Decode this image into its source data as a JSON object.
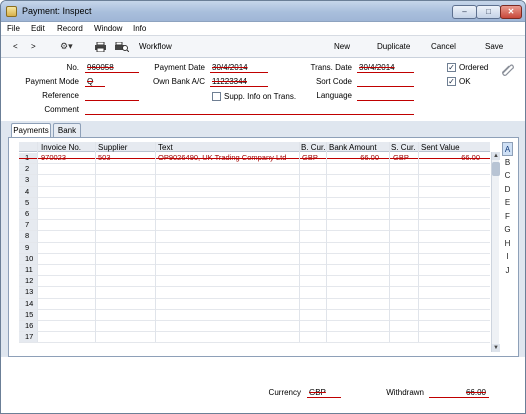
{
  "window": {
    "title": "Payment: Inspect",
    "min": "–",
    "max": "□",
    "close": "✕"
  },
  "menu": [
    "File",
    "Edit",
    "Record",
    "Window",
    "Info"
  ],
  "toolbar": {
    "prev": "<",
    "next": ">",
    "workflow": "Workflow",
    "new": "New",
    "duplicate": "Duplicate",
    "cancel": "Cancel",
    "save": "Save"
  },
  "header": {
    "no_label": "No.",
    "no_value": "960058",
    "payment_date_label": "Payment Date",
    "payment_date_value": "30/4/2014",
    "trans_date_label": "Trans. Date",
    "trans_date_value": "30/4/2014",
    "payment_mode_label": "Payment Mode",
    "payment_mode_value": "Q",
    "own_bank_label": "Own Bank A/C",
    "own_bank_value": "11223344",
    "sort_code_label": "Sort Code",
    "sort_code_value": "",
    "reference_label": "Reference",
    "reference_value": "",
    "supp_info_label": "Supp. Info on Trans.",
    "language_label": "Language",
    "language_value": "",
    "comment_label": "Comment",
    "comment_value": "",
    "ordered_label": "Ordered",
    "ordered_checked": true,
    "ok_label": "OK",
    "ok_checked": true
  },
  "tabs": [
    "Payments",
    "Bank"
  ],
  "grid": {
    "columns": [
      "Invoice No.",
      "Supplier",
      "Text",
      "B. Cur.",
      "Bank Amount",
      "S. Cur.",
      "Sent Value"
    ],
    "rows": [
      {
        "n": "1",
        "invoice": "970023",
        "supplier": "503",
        "text": "OP9026490, UK Trading Company Ltd",
        "bcur": "GBP",
        "bank_amount": "66.00",
        "scur": "GBP",
        "sent_value": "66.00"
      },
      {
        "n": "2"
      },
      {
        "n": "3"
      },
      {
        "n": "4"
      },
      {
        "n": "5"
      },
      {
        "n": "6"
      },
      {
        "n": "7"
      },
      {
        "n": "8"
      },
      {
        "n": "9"
      },
      {
        "n": "10"
      },
      {
        "n": "11"
      },
      {
        "n": "12"
      },
      {
        "n": "13"
      },
      {
        "n": "14"
      },
      {
        "n": "15"
      },
      {
        "n": "16"
      },
      {
        "n": "17"
      }
    ],
    "letters": [
      "A",
      "B",
      "C",
      "D",
      "E",
      "F",
      "G",
      "H",
      "I",
      "J"
    ],
    "selected_letter": "A"
  },
  "footer": {
    "currency_label": "Currency",
    "currency_value": "GBP",
    "withdrawn_label": "Withdrawn",
    "withdrawn_value": "66.00"
  }
}
